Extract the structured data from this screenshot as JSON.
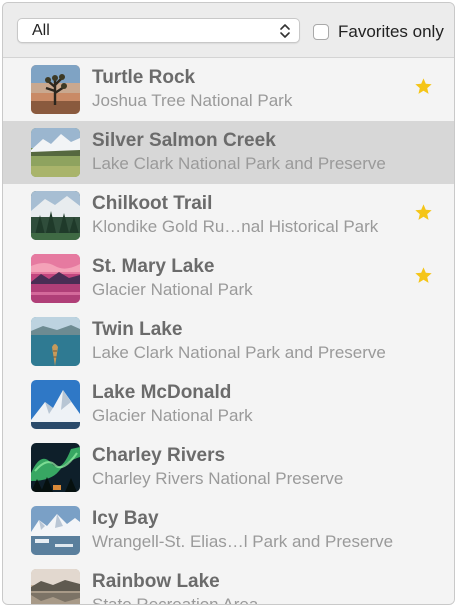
{
  "toolbar": {
    "filter_value": "All",
    "favorites_label": "Favorites only",
    "favorites_checked": false
  },
  "landmarks": [
    {
      "name": "Turtle Rock",
      "park": "Joshua Tree National Park",
      "favorite": true,
      "selected": false,
      "thumb": "desert-joshua-tree"
    },
    {
      "name": "Silver Salmon Creek",
      "park": "Lake Clark National Park and Preserve",
      "favorite": false,
      "selected": true,
      "thumb": "snowy-mountain-meadow"
    },
    {
      "name": "Chilkoot Trail",
      "park": "Klondike Gold Ru…nal Historical Park",
      "favorite": true,
      "selected": false,
      "thumb": "forest-mountain"
    },
    {
      "name": "St. Mary Lake",
      "park": "Glacier National Park",
      "favorite": true,
      "selected": false,
      "thumb": "pink-sunset-lake"
    },
    {
      "name": "Twin Lake",
      "park": "Lake Clark National Park and Preserve",
      "favorite": false,
      "selected": false,
      "thumb": "canoe-lake"
    },
    {
      "name": "Lake McDonald",
      "park": "Glacier National Park",
      "favorite": false,
      "selected": false,
      "thumb": "snow-peak-blue-sky"
    },
    {
      "name": "Charley Rivers",
      "park": "Charley Rivers National Preserve",
      "favorite": false,
      "selected": false,
      "thumb": "aurora-night"
    },
    {
      "name": "Icy Bay",
      "park": "Wrangell-St. Elias…l Park and Preserve",
      "favorite": false,
      "selected": false,
      "thumb": "icy-bay-mountains"
    },
    {
      "name": "Rainbow Lake",
      "park": "State Recreation Area",
      "favorite": false,
      "selected": false,
      "thumb": "lake-reflection"
    }
  ],
  "colors": {
    "star": "#f5c518",
    "selection": "#d7d7d7",
    "title_text": "#6b6b6b",
    "subtitle_text": "#9a9a9a"
  }
}
